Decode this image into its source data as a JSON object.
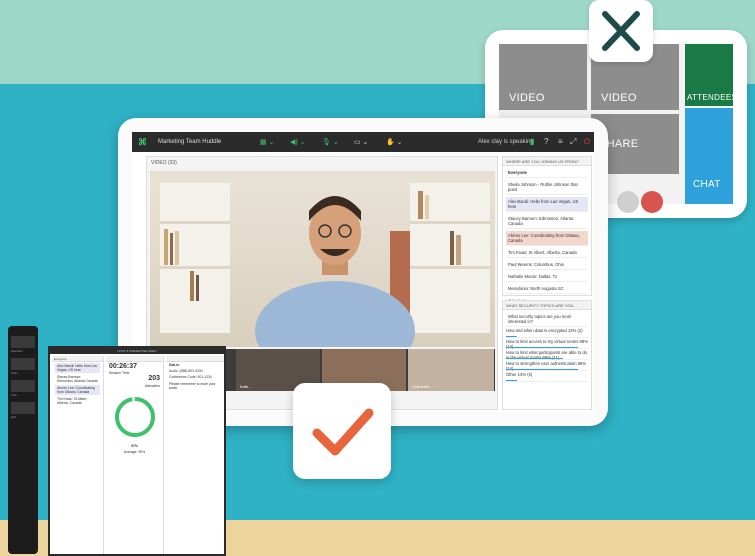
{
  "layout_diagram": {
    "tiles": {
      "video_1": "VIDEO",
      "video_2": "VIDEO",
      "share": "SHARE",
      "attendees": "ATTENDEES",
      "chat": "CHAT"
    },
    "colors": {
      "attendees": "#1a7a45",
      "chat": "#2ea0db",
      "video": "#8d8d8d",
      "dot_red": "#d9534f"
    }
  },
  "close_card": {
    "icon": "close-icon",
    "color": "#1f4a4a"
  },
  "check_card": {
    "icon": "check-icon",
    "color": "#e8643c"
  },
  "meeting": {
    "title": "Marketing Team Huddle",
    "speaker_status": "Alex clay is speaking",
    "video_pod_title": "VIDEO (33)",
    "thumbnails": [
      "Kath...",
      "Brian...",
      "Catherine..."
    ],
    "chat_pod_title": "WHERE ARE YOU JOINING US FROM?",
    "chat_tab": "Everyone",
    "chat_messages": [
      "Sheila Johnson - Ruthie Johnson that point",
      "Alex Bandi: Hello from Las Vegas, US here",
      "Stacey Barnum: Edmonton, Atlanta Canada",
      "Ahmer Lee: Coordinating from Ottawa, Canada",
      "Tim Kivas: St Albert, Alberta, Canada",
      "Paul Weems: Columbus, Ohio",
      "Nathalie Moore: Dallas, Tx",
      "Meredonia: North Augusta SC"
    ],
    "chat_footer": "Type here",
    "poll_pod_title": "WHAT SECURITY TOPICS ARE YOU...",
    "poll_question": "What security topics are you most interested in?",
    "poll_options": [
      {
        "label": "How and when data is encrypted",
        "result": "13% (2)",
        "fraction": 0.13
      },
      {
        "label": "How to limit access to my virtual rooms",
        "result": "88% (14)",
        "fraction": 0.88
      },
      {
        "label": "How to limit what participants are able to do in the virtual rooms",
        "result": "69% (11)",
        "fraction": 0.69
      },
      {
        "label": "How to strengthen user authentication",
        "result": "88% (14)",
        "fraction": 0.88
      },
      {
        "label": "Other",
        "result": "13% (2)",
        "fraction": 0.13
      }
    ]
  },
  "host_panel": {
    "window_title": "HOST & PRESENTER AREA",
    "timer": "00:26:37",
    "timer_label": "Session Time",
    "attendee_count": "203",
    "attendee_label": "Attendees",
    "engagement_pct": "97%",
    "engagement_label": "Average: 95%",
    "notes_heading": "Dial-in",
    "notes_lines": [
      "Audio: (888) 803 4200",
      "Conference Code: 501-1234",
      "Please remember to mute your audio"
    ]
  },
  "phone": {
    "labels": [
      "Attendees",
      "Video",
      "Chat",
      "Q&A"
    ]
  }
}
